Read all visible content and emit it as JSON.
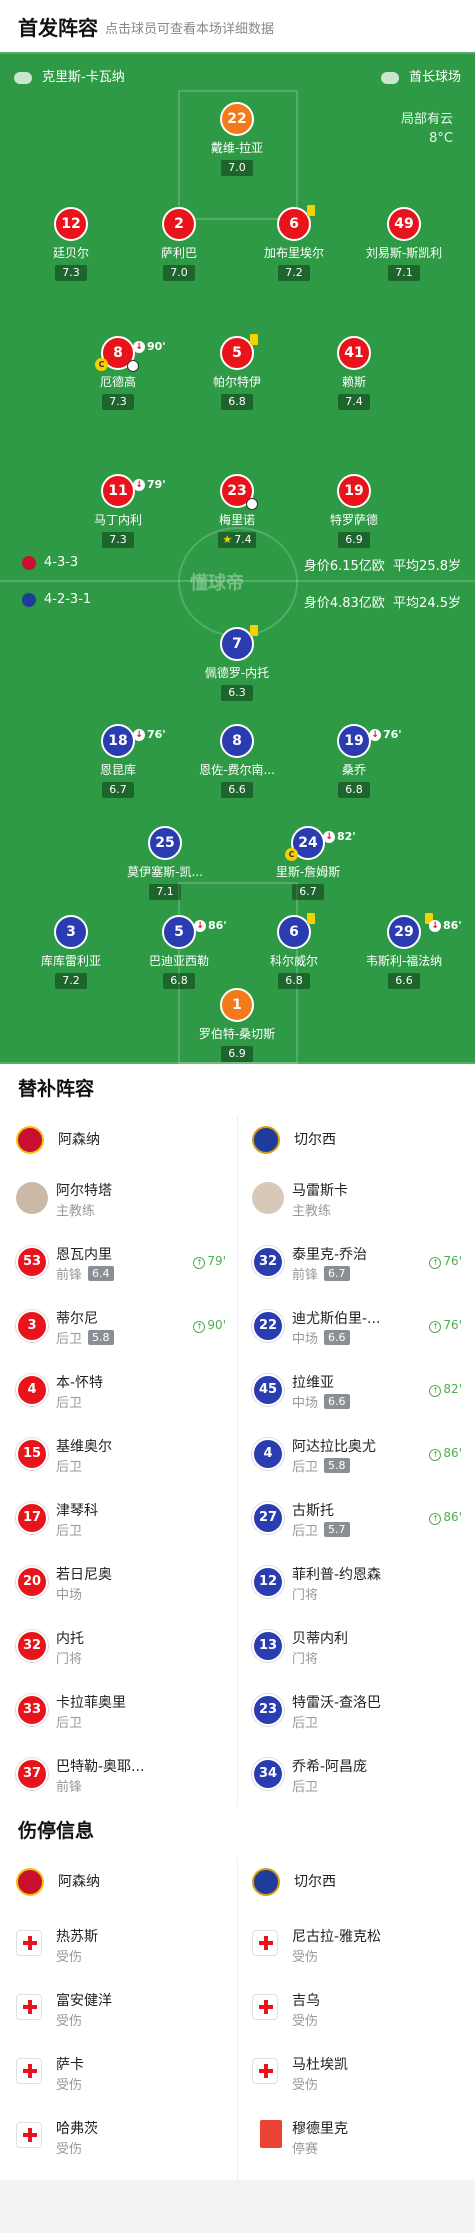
{
  "header": {
    "title": "首发阵容",
    "hint": "点击球员可查看本场详细数据"
  },
  "pitch": {
    "referee": "克里斯-卡瓦纳",
    "venue": "酋长球场",
    "weather": {
      "condition": "局部有云",
      "temperature": "8°C"
    },
    "watermark": "懂球帝",
    "home": {
      "formation": "4-3-3",
      "value": "身价6.15亿欧",
      "age": "平均25.8岁"
    },
    "away": {
      "formation": "4-2-3-1",
      "value": "身价4.83亿欧",
      "age": "平均24.5岁"
    },
    "home_players": [
      {
        "number": "22",
        "name": "戴维-拉亚",
        "rating": "7.0"
      },
      {
        "number": "12",
        "name": "廷贝尔",
        "rating": "7.3"
      },
      {
        "number": "2",
        "name": "萨利巴",
        "rating": "7.0"
      },
      {
        "number": "6",
        "name": "加布里埃尔",
        "rating": "7.2"
      },
      {
        "number": "49",
        "name": "刘易斯-斯凯利",
        "rating": "7.1"
      },
      {
        "number": "8",
        "name": "厄德高",
        "rating": "7.3",
        "sub": "90'"
      },
      {
        "number": "5",
        "name": "帕尔特伊",
        "rating": "6.8"
      },
      {
        "number": "41",
        "name": "赖斯",
        "rating": "7.4"
      },
      {
        "number": "11",
        "name": "马丁内利",
        "rating": "7.3",
        "sub": "79'"
      },
      {
        "number": "23",
        "name": "梅里诺",
        "rating": "7.4"
      },
      {
        "number": "19",
        "name": "特罗萨德",
        "rating": "6.9"
      }
    ],
    "away_players": [
      {
        "number": "7",
        "name": "佩德罗-内托",
        "rating": "6.3"
      },
      {
        "number": "18",
        "name": "恩昆库",
        "rating": "6.7",
        "sub": "76'"
      },
      {
        "number": "8",
        "name": "恩佐-费尔南...",
        "rating": "6.6"
      },
      {
        "number": "19",
        "name": "桑乔",
        "rating": "6.8",
        "sub": "76'"
      },
      {
        "number": "25",
        "name": "莫伊塞斯-凯...",
        "rating": "7.1"
      },
      {
        "number": "24",
        "name": "里斯-詹姆斯",
        "rating": "6.7",
        "sub": "82'"
      },
      {
        "number": "3",
        "name": "库库雷利亚",
        "rating": "7.2"
      },
      {
        "number": "5",
        "name": "巴迪亚西勒",
        "rating": "6.8",
        "sub": "86'"
      },
      {
        "number": "6",
        "name": "科尔威尔",
        "rating": "6.8"
      },
      {
        "number": "29",
        "name": "韦斯利-福法纳",
        "rating": "6.6",
        "sub": "86'"
      },
      {
        "number": "1",
        "name": "罗伯特-桑切斯",
        "rating": "6.9"
      }
    ]
  },
  "subs": {
    "title": "替补阵容",
    "home_team": "阿森纳",
    "away_team": "切尔西",
    "home_coach": {
      "name": "阿尔特塔",
      "role": "主教练"
    },
    "away_coach": {
      "name": "马雷斯卡",
      "role": "主教练"
    },
    "home": [
      {
        "number": "53",
        "name": "恩瓦内里",
        "pos": "前锋",
        "rating": "6.4",
        "in": "79'"
      },
      {
        "number": "3",
        "name": "蒂尔尼",
        "pos": "后卫",
        "rating": "5.8",
        "in": "90'"
      },
      {
        "number": "4",
        "name": "本-怀特",
        "pos": "后卫"
      },
      {
        "number": "15",
        "name": "基维奥尔",
        "pos": "后卫"
      },
      {
        "number": "17",
        "name": "津琴科",
        "pos": "后卫"
      },
      {
        "number": "20",
        "name": "若日尼奥",
        "pos": "中场"
      },
      {
        "number": "32",
        "name": "内托",
        "pos": "门将"
      },
      {
        "number": "33",
        "name": "卡拉菲奥里",
        "pos": "后卫"
      },
      {
        "number": "37",
        "name": "巴特勒-奥耶...",
        "pos": "前锋"
      }
    ],
    "away": [
      {
        "number": "32",
        "name": "泰里克-乔治",
        "pos": "前锋",
        "rating": "6.7",
        "in": "76'"
      },
      {
        "number": "22",
        "name": "迪尤斯伯里-...",
        "pos": "中场",
        "rating": "6.6",
        "in": "76'"
      },
      {
        "number": "45",
        "name": "拉维亚",
        "pos": "中场",
        "rating": "6.6",
        "in": "82'"
      },
      {
        "number": "4",
        "name": "阿达拉比奥尤",
        "pos": "后卫",
        "rating": "5.8",
        "in": "86'"
      },
      {
        "number": "27",
        "name": "古斯托",
        "pos": "后卫",
        "rating": "5.7",
        "in": "86'"
      },
      {
        "number": "12",
        "name": "菲利普-约恩森",
        "pos": "门将"
      },
      {
        "number": "13",
        "name": "贝蒂内利",
        "pos": "门将"
      },
      {
        "number": "23",
        "name": "特雷沃-查洛巴",
        "pos": "后卫"
      },
      {
        "number": "34",
        "name": "乔希-阿昌庞",
        "pos": "后卫"
      }
    ]
  },
  "injuries": {
    "title": "伤停信息",
    "home_team": "阿森纳",
    "away_team": "切尔西",
    "home": [
      {
        "name": "热苏斯",
        "status": "受伤",
        "type": "injury"
      },
      {
        "name": "富安健洋",
        "status": "受伤",
        "type": "injury"
      },
      {
        "name": "萨卡",
        "status": "受伤",
        "type": "injury"
      },
      {
        "name": "哈弗茨",
        "status": "受伤",
        "type": "injury"
      }
    ],
    "away": [
      {
        "name": "尼古拉-雅克松",
        "status": "受伤",
        "type": "injury"
      },
      {
        "name": "吉乌",
        "status": "受伤",
        "type": "injury"
      },
      {
        "name": "马杜埃凯",
        "status": "受伤",
        "type": "injury"
      },
      {
        "name": "穆德里克",
        "status": "停赛",
        "type": "suspension"
      }
    ]
  }
}
